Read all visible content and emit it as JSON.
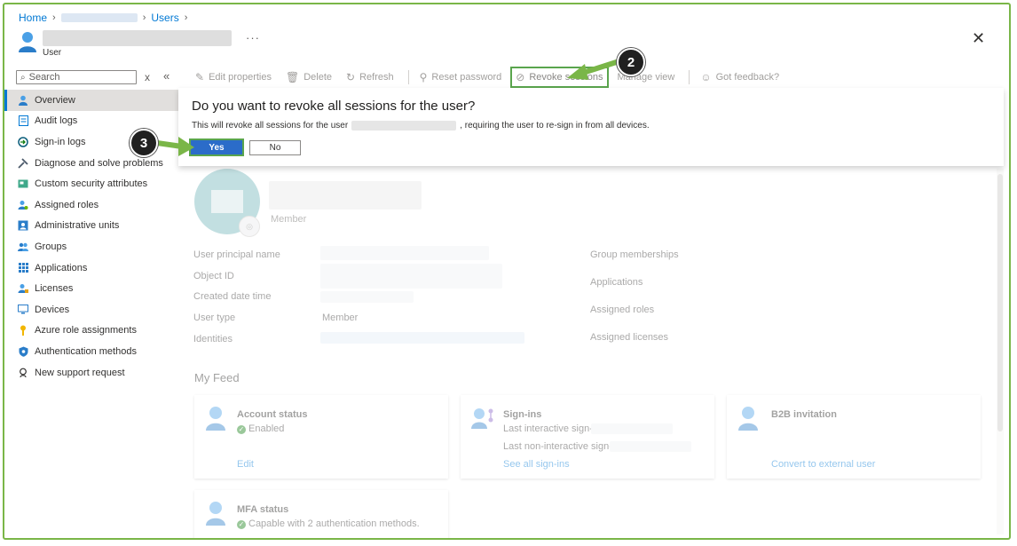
{
  "breadcrumb": {
    "home": "Home",
    "users": "Users"
  },
  "header": {
    "subtitle": "User",
    "more": "···",
    "close": "✕"
  },
  "sidebar": {
    "search_placeholder": "Search",
    "clear": "x",
    "collapse": "«",
    "items": [
      {
        "label": "Overview",
        "icon": "person-icon",
        "active": true
      },
      {
        "label": "Audit logs",
        "icon": "log-icon"
      },
      {
        "label": "Sign-in logs",
        "icon": "signin-icon"
      },
      {
        "label": "Diagnose and solve problems",
        "icon": "wrench-icon"
      },
      {
        "label": "Custom security attributes",
        "icon": "attribute-icon"
      },
      {
        "label": "Assigned roles",
        "icon": "role-icon"
      },
      {
        "label": "Administrative units",
        "icon": "admin-unit-icon"
      },
      {
        "label": "Groups",
        "icon": "group-icon"
      },
      {
        "label": "Applications",
        "icon": "apps-grid-icon"
      },
      {
        "label": "Licenses",
        "icon": "license-icon"
      },
      {
        "label": "Devices",
        "icon": "device-icon"
      },
      {
        "label": "Azure role assignments",
        "icon": "key-icon"
      },
      {
        "label": "Authentication methods",
        "icon": "shield-icon"
      },
      {
        "label": "New support request",
        "icon": "support-icon"
      }
    ]
  },
  "toolbar": {
    "edit": "Edit properties",
    "delete": "Delete",
    "refresh": "Refresh",
    "reset": "Reset password",
    "revoke": "Revoke sessions",
    "manage": "Manage view",
    "feedback": "Got feedback?"
  },
  "dialog": {
    "title": "Do you want to revoke all sessions for the user?",
    "text_before": "This will revoke all sessions for the user",
    "text_after": ", requiring the user to re-sign in from all devices.",
    "yes": "Yes",
    "no": "No"
  },
  "callouts": {
    "step2": "2",
    "step3": "3"
  },
  "profile": {
    "member": "Member",
    "left_props": [
      "User principal name",
      "Object ID",
      "Created date time",
      "User type",
      "Identities"
    ],
    "user_type_value": "Member",
    "right_props": [
      "Group memberships",
      "Applications",
      "Assigned roles",
      "Assigned licenses"
    ]
  },
  "feed": {
    "title": "My Feed",
    "account": {
      "title": "Account status",
      "status": "Enabled",
      "link": "Edit"
    },
    "signins": {
      "title": "Sign-ins",
      "last_interactive": "Last interactive sign-in:",
      "last_noninteractive": "Last non-interactive sign-in:",
      "link": "See all sign-ins"
    },
    "b2b": {
      "title": "B2B invitation",
      "link": "Convert to external user"
    },
    "mfa": {
      "title": "MFA status",
      "status": "Capable with 2 authentication methods."
    }
  },
  "colors": {
    "accent": "#0078d4",
    "highlight": "#5aa54d",
    "callout": "#202020"
  }
}
